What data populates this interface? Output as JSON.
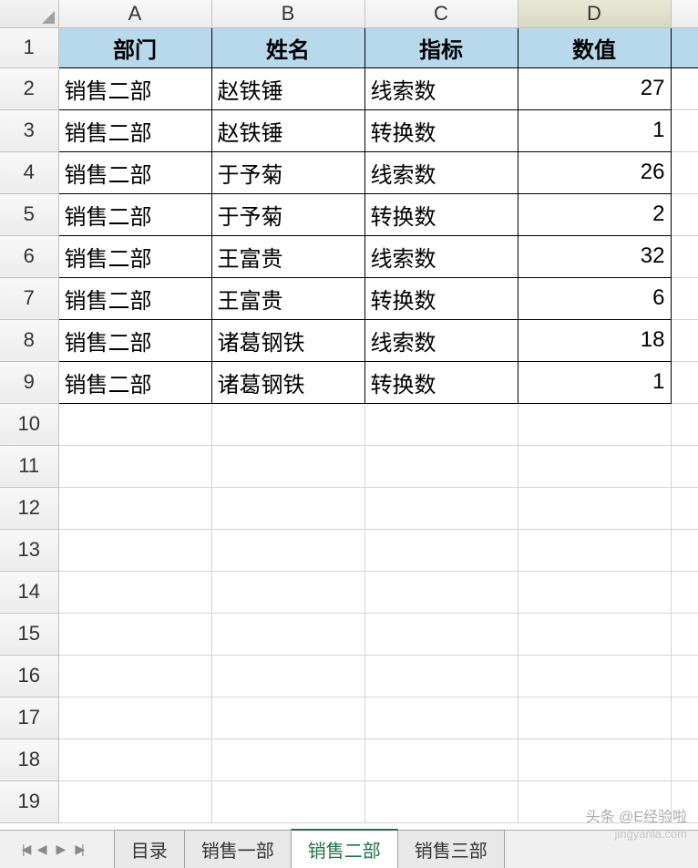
{
  "columns": [
    "A",
    "B",
    "C",
    "D"
  ],
  "selected_column": "D",
  "headers": {
    "A": "部门",
    "B": "姓名",
    "C": "指标",
    "D": "数值"
  },
  "rows": [
    {
      "n": 2,
      "A": "销售二部",
      "B": "赵铁锤",
      "C": "线索数",
      "D": "27"
    },
    {
      "n": 3,
      "A": "销售二部",
      "B": "赵铁锤",
      "C": "转换数",
      "D": "1"
    },
    {
      "n": 4,
      "A": "销售二部",
      "B": "于予菊",
      "C": "线索数",
      "D": "26"
    },
    {
      "n": 5,
      "A": "销售二部",
      "B": "于予菊",
      "C": "转换数",
      "D": "2"
    },
    {
      "n": 6,
      "A": "销售二部",
      "B": "王富贵",
      "C": "线索数",
      "D": "32"
    },
    {
      "n": 7,
      "A": "销售二部",
      "B": "王富贵",
      "C": "转换数",
      "D": "6"
    },
    {
      "n": 8,
      "A": "销售二部",
      "B": "诸葛钢铁",
      "C": "线索数",
      "D": "18"
    },
    {
      "n": 9,
      "A": "销售二部",
      "B": "诸葛钢铁",
      "C": "转换数",
      "D": "1"
    }
  ],
  "empty_rows": [
    10,
    11,
    12,
    13,
    14,
    15,
    16,
    17,
    18,
    19
  ],
  "tabs": {
    "items": [
      "目录",
      "销售一部",
      "销售二部",
      "销售三部"
    ],
    "active": "销售二部"
  },
  "watermark_top": "头条 @E经验啦",
  "watermark_bottom": "jingyanla.com",
  "header_row_num": "1"
}
